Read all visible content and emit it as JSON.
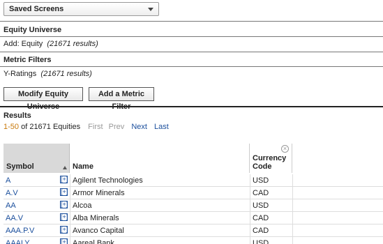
{
  "saved_screens": {
    "label": "Saved Screens"
  },
  "equity_universe": {
    "title": "Equity Universe",
    "prefix": "Add: Equity",
    "results": "(21671 results)"
  },
  "metric_filters": {
    "title": "Metric Filters",
    "prefix": "Y-Ratings",
    "results": "(21671 results)"
  },
  "buttons": {
    "modify": "Modify Equity Universe",
    "add_metric": "Add a Metric Filter"
  },
  "results": {
    "title": "Results",
    "range": "1-50",
    "suffix": "of 21671 Equities",
    "first": "First",
    "prev": "Prev",
    "next": "Next",
    "last": "Last"
  },
  "table": {
    "headers": {
      "symbol": "Symbol",
      "name": "Name",
      "currency": "Currency Code"
    },
    "add_glyph": "[+]",
    "close_glyph": "×",
    "rows": [
      {
        "symbol": "A",
        "name": "Agilent Technologies",
        "currency": "USD"
      },
      {
        "symbol": "A.V",
        "name": "Armor Minerals",
        "currency": "CAD"
      },
      {
        "symbol": "AA",
        "name": "Alcoa",
        "currency": "USD"
      },
      {
        "symbol": "AA.V",
        "name": "Alba Minerals",
        "currency": "CAD"
      },
      {
        "symbol": "AAA.P.V",
        "name": "Avanco Capital",
        "currency": "CAD"
      },
      {
        "symbol": "AAALY",
        "name": "Aareal Bank",
        "currency": "USD"
      }
    ]
  }
}
